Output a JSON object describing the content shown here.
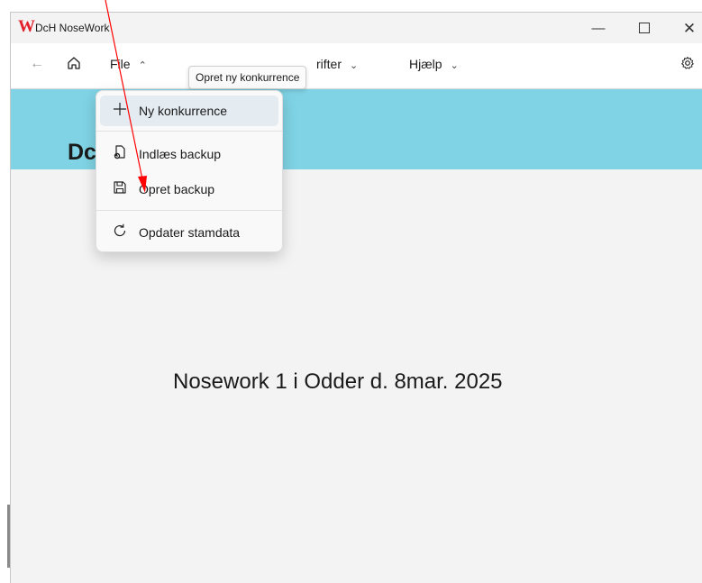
{
  "window": {
    "title": "DcH NoseWork",
    "logo_letter": "W",
    "min_glyph": "—",
    "close_glyph": "✕"
  },
  "toolbar": {
    "back_icon": "←",
    "home_icon": "home-icon",
    "file_label": "File",
    "file_chevron": "⌃",
    "skrifter_label": "rifter",
    "skrifter_chevron": "⌄",
    "help_label": "Hjælp",
    "help_chevron": "⌄",
    "settings_icon": "gear-icon"
  },
  "tooltip": {
    "text": "Opret ny konkurrence"
  },
  "file_menu": {
    "items": [
      {
        "label": "Ny konkurrence",
        "icon": "plus-icon"
      },
      {
        "label": "Indlæs backup",
        "icon": "file-restore-icon"
      },
      {
        "label": "Opret backup",
        "icon": "save-icon"
      },
      {
        "label": "Opdater stamdata",
        "icon": "refresh-icon"
      }
    ]
  },
  "banner": {
    "title": "Dc"
  },
  "main": {
    "event_title": "Nosework 1 i Odder d. 8mar. 2025"
  },
  "colors": {
    "banner_bg": "#7fd3e4",
    "accent_red": "#e3202b",
    "annotation_arrow": "#ff0000"
  }
}
